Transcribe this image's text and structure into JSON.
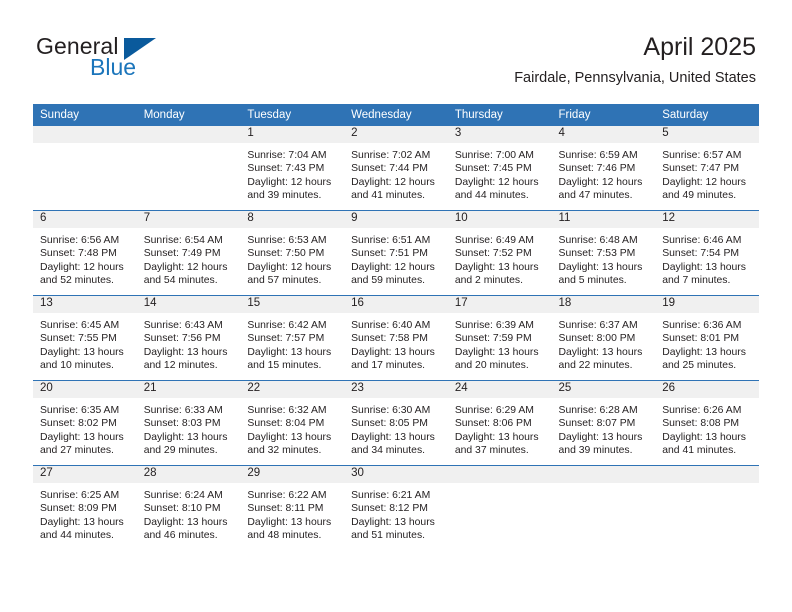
{
  "brand": {
    "name_part1": "General",
    "name_part2": "Blue",
    "triangle_color": "#0a5a9c",
    "blue_color": "#1b75bb"
  },
  "header": {
    "title": "April 2025",
    "subtitle": "Fairdale, Pennsylvania, United States",
    "accent_color": "#2f73b5",
    "band_color": "#f0f0f0"
  },
  "calendar": {
    "weekdays": [
      "Sunday",
      "Monday",
      "Tuesday",
      "Wednesday",
      "Thursday",
      "Friday",
      "Saturday"
    ],
    "weeks": [
      [
        {
          "day": "",
          "sunrise": "",
          "sunset": "",
          "daylight_1": "",
          "daylight_2": ""
        },
        {
          "day": "",
          "sunrise": "",
          "sunset": "",
          "daylight_1": "",
          "daylight_2": ""
        },
        {
          "day": "1",
          "sunrise": "Sunrise: 7:04 AM",
          "sunset": "Sunset: 7:43 PM",
          "daylight_1": "Daylight: 12 hours",
          "daylight_2": "and 39 minutes."
        },
        {
          "day": "2",
          "sunrise": "Sunrise: 7:02 AM",
          "sunset": "Sunset: 7:44 PM",
          "daylight_1": "Daylight: 12 hours",
          "daylight_2": "and 41 minutes."
        },
        {
          "day": "3",
          "sunrise": "Sunrise: 7:00 AM",
          "sunset": "Sunset: 7:45 PM",
          "daylight_1": "Daylight: 12 hours",
          "daylight_2": "and 44 minutes."
        },
        {
          "day": "4",
          "sunrise": "Sunrise: 6:59 AM",
          "sunset": "Sunset: 7:46 PM",
          "daylight_1": "Daylight: 12 hours",
          "daylight_2": "and 47 minutes."
        },
        {
          "day": "5",
          "sunrise": "Sunrise: 6:57 AM",
          "sunset": "Sunset: 7:47 PM",
          "daylight_1": "Daylight: 12 hours",
          "daylight_2": "and 49 minutes."
        }
      ],
      [
        {
          "day": "6",
          "sunrise": "Sunrise: 6:56 AM",
          "sunset": "Sunset: 7:48 PM",
          "daylight_1": "Daylight: 12 hours",
          "daylight_2": "and 52 minutes."
        },
        {
          "day": "7",
          "sunrise": "Sunrise: 6:54 AM",
          "sunset": "Sunset: 7:49 PM",
          "daylight_1": "Daylight: 12 hours",
          "daylight_2": "and 54 minutes."
        },
        {
          "day": "8",
          "sunrise": "Sunrise: 6:53 AM",
          "sunset": "Sunset: 7:50 PM",
          "daylight_1": "Daylight: 12 hours",
          "daylight_2": "and 57 minutes."
        },
        {
          "day": "9",
          "sunrise": "Sunrise: 6:51 AM",
          "sunset": "Sunset: 7:51 PM",
          "daylight_1": "Daylight: 12 hours",
          "daylight_2": "and 59 minutes."
        },
        {
          "day": "10",
          "sunrise": "Sunrise: 6:49 AM",
          "sunset": "Sunset: 7:52 PM",
          "daylight_1": "Daylight: 13 hours",
          "daylight_2": "and 2 minutes."
        },
        {
          "day": "11",
          "sunrise": "Sunrise: 6:48 AM",
          "sunset": "Sunset: 7:53 PM",
          "daylight_1": "Daylight: 13 hours",
          "daylight_2": "and 5 minutes."
        },
        {
          "day": "12",
          "sunrise": "Sunrise: 6:46 AM",
          "sunset": "Sunset: 7:54 PM",
          "daylight_1": "Daylight: 13 hours",
          "daylight_2": "and 7 minutes."
        }
      ],
      [
        {
          "day": "13",
          "sunrise": "Sunrise: 6:45 AM",
          "sunset": "Sunset: 7:55 PM",
          "daylight_1": "Daylight: 13 hours",
          "daylight_2": "and 10 minutes."
        },
        {
          "day": "14",
          "sunrise": "Sunrise: 6:43 AM",
          "sunset": "Sunset: 7:56 PM",
          "daylight_1": "Daylight: 13 hours",
          "daylight_2": "and 12 minutes."
        },
        {
          "day": "15",
          "sunrise": "Sunrise: 6:42 AM",
          "sunset": "Sunset: 7:57 PM",
          "daylight_1": "Daylight: 13 hours",
          "daylight_2": "and 15 minutes."
        },
        {
          "day": "16",
          "sunrise": "Sunrise: 6:40 AM",
          "sunset": "Sunset: 7:58 PM",
          "daylight_1": "Daylight: 13 hours",
          "daylight_2": "and 17 minutes."
        },
        {
          "day": "17",
          "sunrise": "Sunrise: 6:39 AM",
          "sunset": "Sunset: 7:59 PM",
          "daylight_1": "Daylight: 13 hours",
          "daylight_2": "and 20 minutes."
        },
        {
          "day": "18",
          "sunrise": "Sunrise: 6:37 AM",
          "sunset": "Sunset: 8:00 PM",
          "daylight_1": "Daylight: 13 hours",
          "daylight_2": "and 22 minutes."
        },
        {
          "day": "19",
          "sunrise": "Sunrise: 6:36 AM",
          "sunset": "Sunset: 8:01 PM",
          "daylight_1": "Daylight: 13 hours",
          "daylight_2": "and 25 minutes."
        }
      ],
      [
        {
          "day": "20",
          "sunrise": "Sunrise: 6:35 AM",
          "sunset": "Sunset: 8:02 PM",
          "daylight_1": "Daylight: 13 hours",
          "daylight_2": "and 27 minutes."
        },
        {
          "day": "21",
          "sunrise": "Sunrise: 6:33 AM",
          "sunset": "Sunset: 8:03 PM",
          "daylight_1": "Daylight: 13 hours",
          "daylight_2": "and 29 minutes."
        },
        {
          "day": "22",
          "sunrise": "Sunrise: 6:32 AM",
          "sunset": "Sunset: 8:04 PM",
          "daylight_1": "Daylight: 13 hours",
          "daylight_2": "and 32 minutes."
        },
        {
          "day": "23",
          "sunrise": "Sunrise: 6:30 AM",
          "sunset": "Sunset: 8:05 PM",
          "daylight_1": "Daylight: 13 hours",
          "daylight_2": "and 34 minutes."
        },
        {
          "day": "24",
          "sunrise": "Sunrise: 6:29 AM",
          "sunset": "Sunset: 8:06 PM",
          "daylight_1": "Daylight: 13 hours",
          "daylight_2": "and 37 minutes."
        },
        {
          "day": "25",
          "sunrise": "Sunrise: 6:28 AM",
          "sunset": "Sunset: 8:07 PM",
          "daylight_1": "Daylight: 13 hours",
          "daylight_2": "and 39 minutes."
        },
        {
          "day": "26",
          "sunrise": "Sunrise: 6:26 AM",
          "sunset": "Sunset: 8:08 PM",
          "daylight_1": "Daylight: 13 hours",
          "daylight_2": "and 41 minutes."
        }
      ],
      [
        {
          "day": "27",
          "sunrise": "Sunrise: 6:25 AM",
          "sunset": "Sunset: 8:09 PM",
          "daylight_1": "Daylight: 13 hours",
          "daylight_2": "and 44 minutes."
        },
        {
          "day": "28",
          "sunrise": "Sunrise: 6:24 AM",
          "sunset": "Sunset: 8:10 PM",
          "daylight_1": "Daylight: 13 hours",
          "daylight_2": "and 46 minutes."
        },
        {
          "day": "29",
          "sunrise": "Sunrise: 6:22 AM",
          "sunset": "Sunset: 8:11 PM",
          "daylight_1": "Daylight: 13 hours",
          "daylight_2": "and 48 minutes."
        },
        {
          "day": "30",
          "sunrise": "Sunrise: 6:21 AM",
          "sunset": "Sunset: 8:12 PM",
          "daylight_1": "Daylight: 13 hours",
          "daylight_2": "and 51 minutes."
        },
        {
          "day": "",
          "sunrise": "",
          "sunset": "",
          "daylight_1": "",
          "daylight_2": ""
        },
        {
          "day": "",
          "sunrise": "",
          "sunset": "",
          "daylight_1": "",
          "daylight_2": ""
        },
        {
          "day": "",
          "sunrise": "",
          "sunset": "",
          "daylight_1": "",
          "daylight_2": ""
        }
      ]
    ]
  }
}
